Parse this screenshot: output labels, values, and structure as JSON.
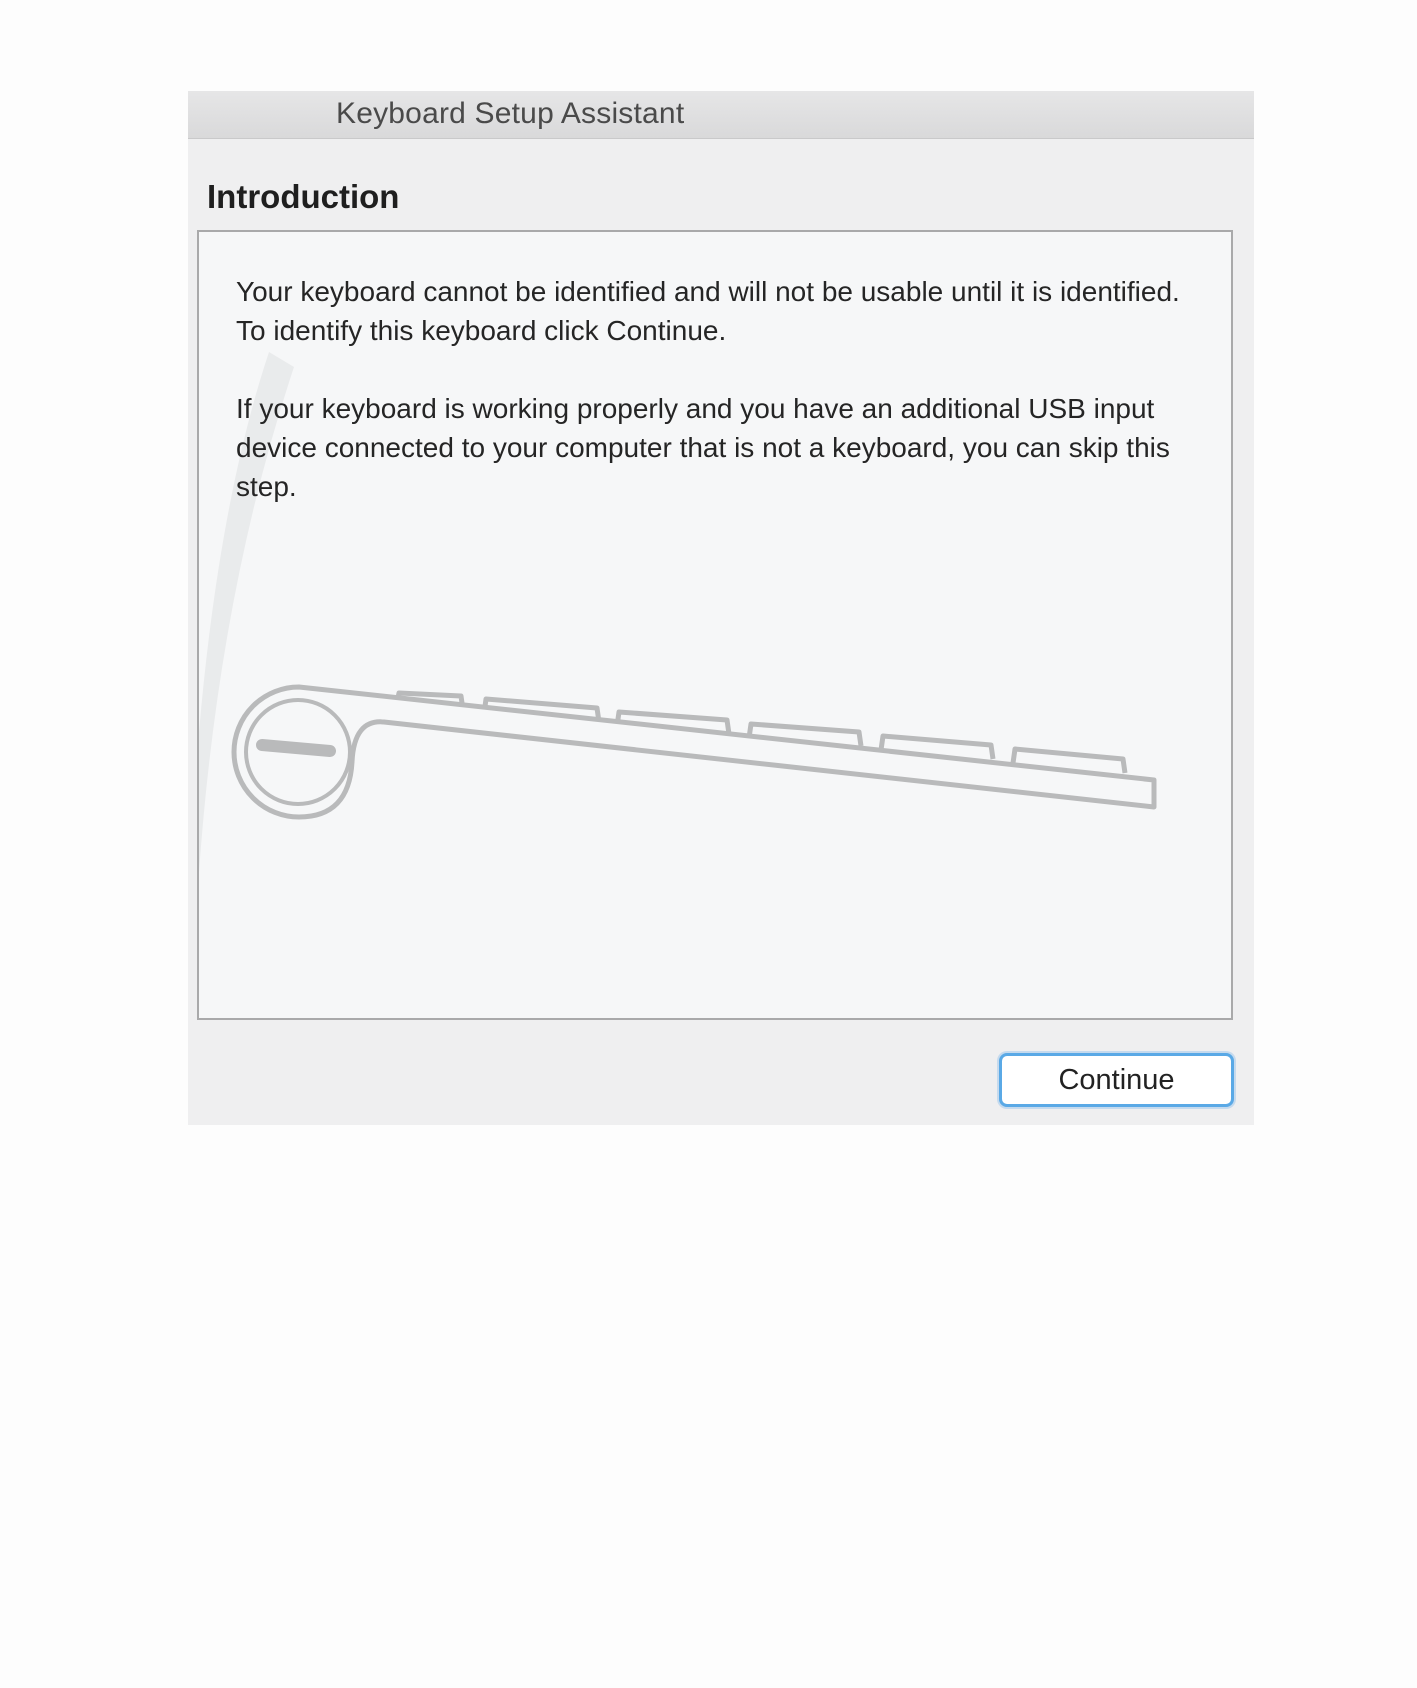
{
  "window": {
    "title": "Keyboard Setup Assistant"
  },
  "page": {
    "heading": "Introduction",
    "paragraphs": [
      "Your keyboard cannot be identified and will not be usable until it is identified. To identify this keyboard click Continue.",
      "If your keyboard is working properly and you have an additional USB input device connected to your computer that is not a keyboard, you can skip this step."
    ],
    "illustration_icon": "keyboard-side-view-icon"
  },
  "buttons": {
    "continue_label": "Continue"
  },
  "colors": {
    "accent": "#5aa9e6",
    "window_bg": "#efeff0",
    "content_bg": "#f6f7f8"
  }
}
